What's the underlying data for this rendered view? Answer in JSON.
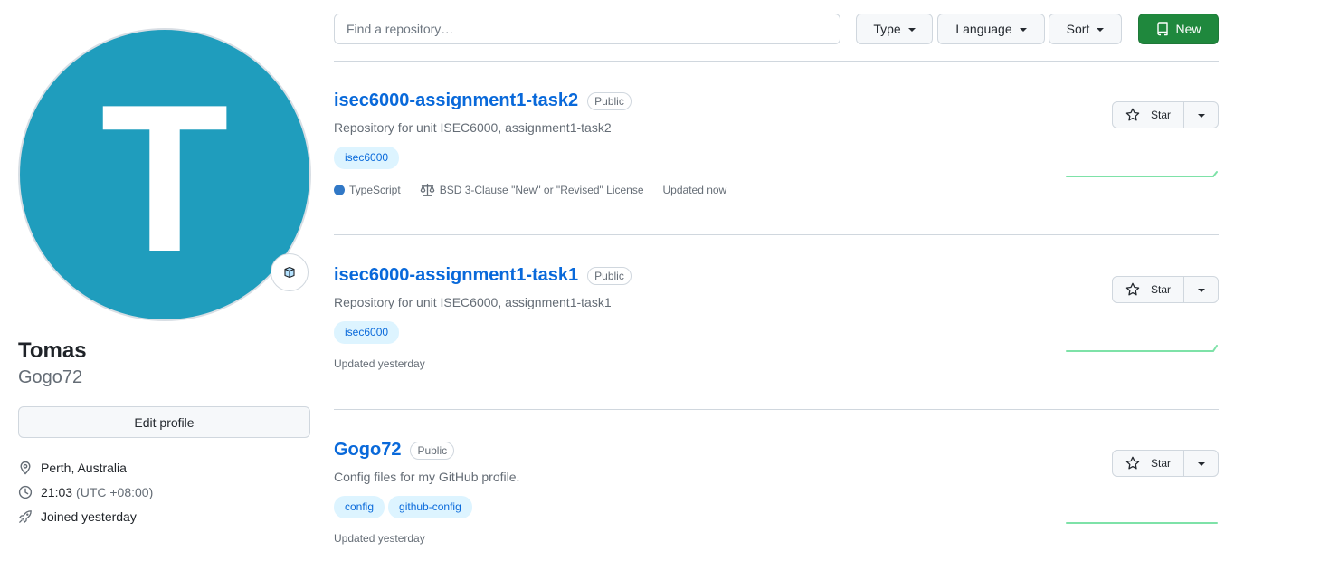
{
  "profile": {
    "avatar_letter": "T",
    "avatar_color": "#1f9dbd",
    "status_icon": "smiley-status-icon",
    "name": "Tomas",
    "login": "Gogo72",
    "edit_label": "Edit profile",
    "location": "Perth, Australia",
    "local_time": "21:03",
    "timezone": "(UTC +08:00)",
    "joined": "Joined yesterday"
  },
  "filters": {
    "search_placeholder": "Find a repository…",
    "type_label": "Type",
    "language_label": "Language",
    "sort_label": "Sort",
    "new_label": "New"
  },
  "repos": [
    {
      "name": "isec6000-assignment1-task2",
      "visibility": "Public",
      "description": "Repository for unit ISEC6000, assignment1-task2",
      "topics": [
        "isec6000"
      ],
      "language": "TypeScript",
      "language_color": "#3178c6",
      "license": "BSD 3-Clause \"New\" or \"Revised\" License",
      "updated": "Updated now",
      "star_label": "Star"
    },
    {
      "name": "isec6000-assignment1-task1",
      "visibility": "Public",
      "description": "Repository for unit ISEC6000, assignment1-task1",
      "topics": [
        "isec6000"
      ],
      "updated": "Updated yesterday",
      "star_label": "Star"
    },
    {
      "name": "Gogo72",
      "visibility": "Public",
      "description": "Config files for my GitHub profile.",
      "topics": [
        "config",
        "github-config"
      ],
      "updated": "Updated yesterday",
      "star_label": "Star"
    }
  ],
  "colors": {
    "link": "#0969da",
    "primary_button": "#1f883d",
    "sparkline": "#7ee2a8"
  }
}
